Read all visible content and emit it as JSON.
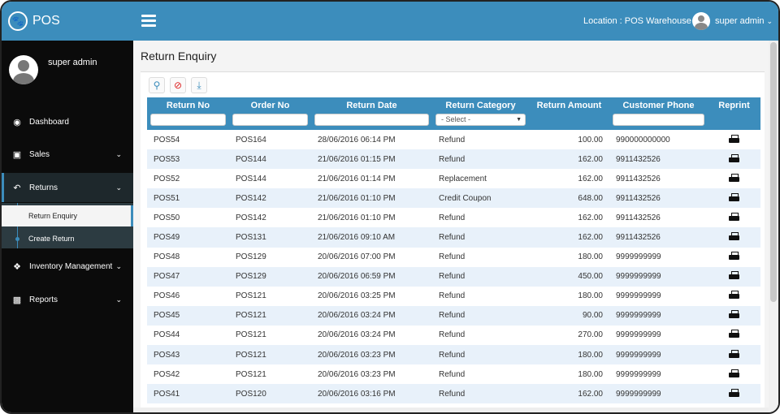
{
  "header": {
    "brand": "POS",
    "location": "Location : POS Warehouse",
    "user": "super admin"
  },
  "sidebar": {
    "profile_name": "super admin",
    "items": [
      {
        "label": "Dashboard",
        "icon": "dashboard-icon"
      },
      {
        "label": "Sales",
        "icon": "money-icon"
      },
      {
        "label": "Returns",
        "icon": "return-icon"
      },
      {
        "label": "Inventory Management",
        "icon": "cubes-icon"
      },
      {
        "label": "Reports",
        "icon": "bar-chart-icon"
      }
    ],
    "submenu": [
      "Return Enquiry",
      "Create Return"
    ]
  },
  "page": {
    "title": "Return Enquiry"
  },
  "table": {
    "headers": [
      "Return No",
      "Order No",
      "Return Date",
      "Return Category",
      "Return Amount",
      "Customer Phone",
      "Reprint"
    ],
    "category_select": "- Select -",
    "rows": [
      [
        "POS54",
        "POS164",
        "28/06/2016 06:14 PM",
        "Refund",
        "100.00",
        "990000000000"
      ],
      [
        "POS53",
        "POS144",
        "21/06/2016 01:15 PM",
        "Refund",
        "162.00",
        "9911432526"
      ],
      [
        "POS52",
        "POS144",
        "21/06/2016 01:14 PM",
        "Replacement",
        "162.00",
        "9911432526"
      ],
      [
        "POS51",
        "POS142",
        "21/06/2016 01:10 PM",
        "Credit Coupon",
        "648.00",
        "9911432526"
      ],
      [
        "POS50",
        "POS142",
        "21/06/2016 01:10 PM",
        "Refund",
        "162.00",
        "9911432526"
      ],
      [
        "POS49",
        "POS131",
        "21/06/2016 09:10 AM",
        "Refund",
        "162.00",
        "9911432526"
      ],
      [
        "POS48",
        "POS129",
        "20/06/2016 07:00 PM",
        "Refund",
        "180.00",
        "9999999999"
      ],
      [
        "POS47",
        "POS129",
        "20/06/2016 06:59 PM",
        "Refund",
        "450.00",
        "9999999999"
      ],
      [
        "POS46",
        "POS121",
        "20/06/2016 03:25 PM",
        "Refund",
        "180.00",
        "9999999999"
      ],
      [
        "POS45",
        "POS121",
        "20/06/2016 03:24 PM",
        "Refund",
        "90.00",
        "9999999999"
      ],
      [
        "POS44",
        "POS121",
        "20/06/2016 03:24 PM",
        "Refund",
        "270.00",
        "9999999999"
      ],
      [
        "POS43",
        "POS121",
        "20/06/2016 03:23 PM",
        "Refund",
        "180.00",
        "9999999999"
      ],
      [
        "POS42",
        "POS121",
        "20/06/2016 03:23 PM",
        "Refund",
        "180.00",
        "9999999999"
      ],
      [
        "POS41",
        "POS120",
        "20/06/2016 03:16 PM",
        "Refund",
        "162.00",
        "9999999999"
      ]
    ]
  },
  "colors": {
    "primary": "#3c8dbc",
    "sidebar": "#0b0b0b",
    "row_alt": "#e8f1fa"
  }
}
